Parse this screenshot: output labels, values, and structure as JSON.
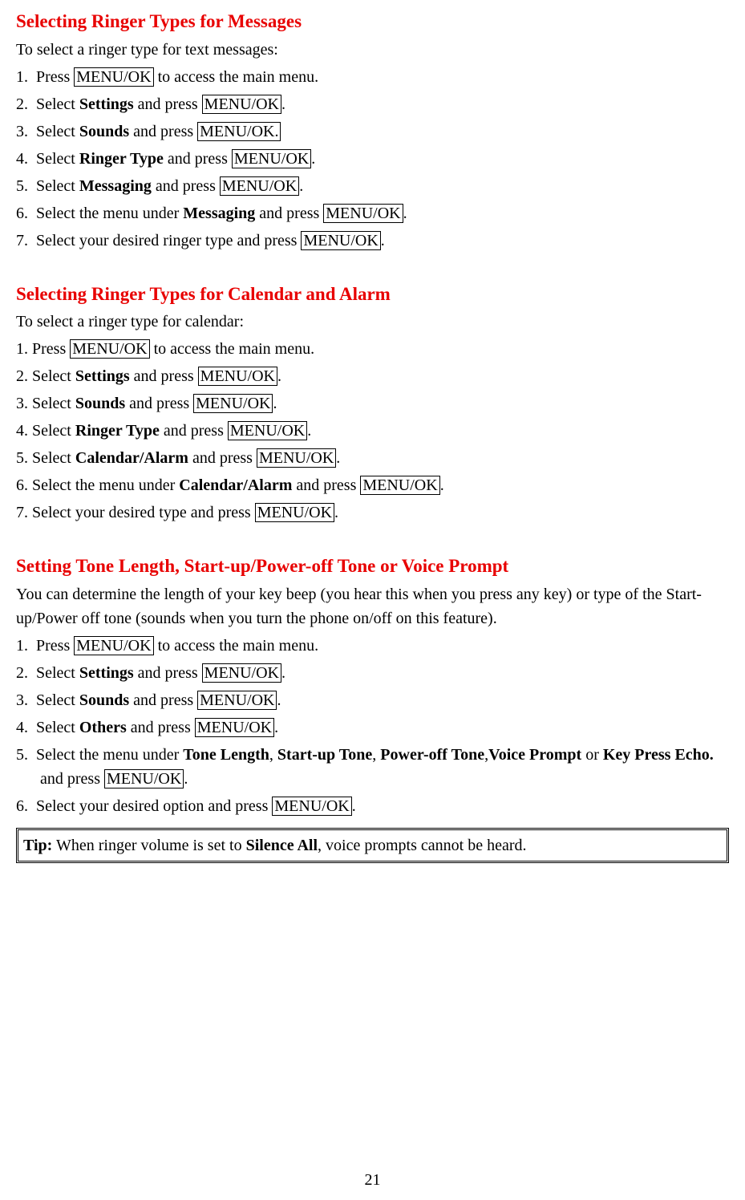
{
  "section1": {
    "heading": "Selecting Ringer Types for Messages",
    "intro": "To select a ringer type for text messages:",
    "steps": {
      "s1_num": "1.",
      "s1_pre": "Press ",
      "s1_box": "MENU/OK",
      "s1_post": " to access the main menu.",
      "s2_num": "2.",
      "s2_pre": "Select ",
      "s2_bold": "Settings",
      "s2_mid": " and press ",
      "s2_box": "MENU/OK",
      "s2_post": ".",
      "s3_num": "3.",
      "s3_pre": "Select ",
      "s3_bold": "Sounds",
      "s3_mid": " and press ",
      "s3_box": "MENU/OK.",
      "s4_num": "4.",
      "s4_pre": "Select ",
      "s4_bold": "Ringer Type",
      "s4_mid": " and press ",
      "s4_box": "MENU/OK",
      "s4_post": ".",
      "s5_num": "5.",
      "s5_pre": "Select ",
      "s5_bold": "Messaging",
      "s5_mid": " and press ",
      "s5_box": "MENU/OK",
      "s5_post": ".",
      "s6_num": "6.",
      "s6_pre": "Select the menu under ",
      "s6_bold": "Messaging",
      "s6_mid": " and press ",
      "s6_box": "MENU/OK",
      "s6_post": ".",
      "s7_num": "7.",
      "s7_pre": "Select your desired ringer type and press ",
      "s7_box": "MENU/OK",
      "s7_post": "."
    }
  },
  "section2": {
    "heading": "Selecting Ringer Types for Calendar and Alarm",
    "intro": "To select a ringer type for calendar:",
    "steps": {
      "s1_pre": "1. Press ",
      "s1_box": "MENU/OK",
      "s1_post": " to access the main menu.",
      "s2_pre": "2. Select ",
      "s2_bold": "Settings",
      "s2_mid": " and press ",
      "s2_box": "MENU/OK",
      "s2_post": ".",
      "s3_pre": "3. Select ",
      "s3_bold": "Sounds",
      "s3_mid": " and press ",
      "s3_box": "MENU/OK",
      "s3_post": ".",
      "s4_pre": "4. Select ",
      "s4_bold": "Ringer Type",
      "s4_mid": " and press ",
      "s4_box": "MENU/OK",
      "s4_post": ".",
      "s5_pre": "5. Select ",
      "s5_bold": "Calendar/Alarm",
      "s5_mid": " and press ",
      "s5_box": "MENU/OK",
      "s5_post": ".",
      "s6_pre": "6. Select the menu under ",
      "s6_bold": "Calendar/Alarm",
      "s6_mid": " and press ",
      "s6_box": "MENU/OK",
      "s6_post": ".",
      "s7_pre": "7. Select your desired type and press ",
      "s7_box": "MENU/OK",
      "s7_post": "."
    }
  },
  "section3": {
    "heading": "Setting Tone Length, Start-up/Power-off Tone or Voice Prompt",
    "intro": "You can determine the length of your key beep (you hear this when you press any key) or type of the Start-up/Power off tone (sounds when you turn the phone on/off on this feature).",
    "steps": {
      "s1_num": "1.",
      "s1_pre": "Press ",
      "s1_box": "MENU/OK",
      "s1_post": " to access the main menu.",
      "s2_num": "2.",
      "s2_pre": "Select ",
      "s2_bold": "Settings",
      "s2_mid": " and press ",
      "s2_box": "MENU/OK",
      "s2_post": ".",
      "s3_num": "3.",
      "s3_pre": "Select ",
      "s3_bold": "Sounds",
      "s3_mid": " and press ",
      "s3_box": "MENU/OK",
      "s3_post": ".",
      "s4_num": "4.",
      "s4_pre": "Select ",
      "s4_bold": "Others",
      "s4_mid": " and press ",
      "s4_box": "MENU/OK",
      "s4_post": ".",
      "s5_num": "5.",
      "s5_pre": "Select the menu under ",
      "s5_b1": "Tone Length",
      "s5_sep1": ", ",
      "s5_b2": "Start-up Tone",
      "s5_sep2": ", ",
      "s5_b3": "Power-off Tone",
      "s5_sep3": ",",
      "s5_b4": "Voice Prompt",
      "s5_mid": "  or ",
      "s5_b5": "Key Press Echo.",
      "s5_mid2": " and press ",
      "s5_box": "MENU/OK",
      "s5_post": ".",
      "s6_num": "6.",
      "s6_pre": "Select your desired option and press ",
      "s6_box": "MENU/OK",
      "s6_post": "."
    }
  },
  "tip": {
    "label": "Tip:",
    "pre": " When ringer volume is set to ",
    "bold": "Silence All",
    "post": ", voice prompts cannot be heard."
  },
  "page_number": "21"
}
